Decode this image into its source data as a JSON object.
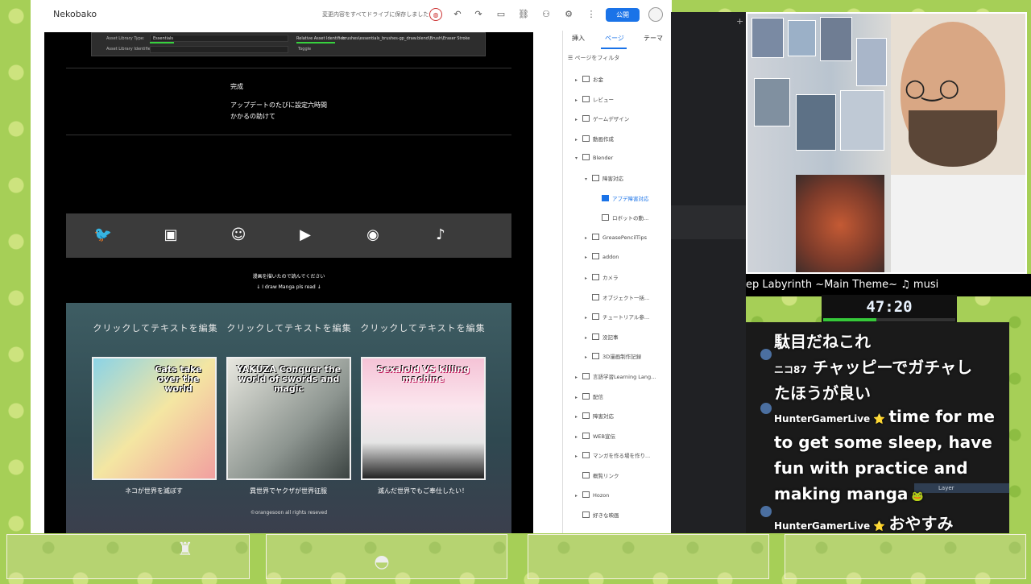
{
  "app": {
    "title": "Nekobako",
    "save_status": "変更内容をすべてドライブに保存しました",
    "publish": "公開"
  },
  "asset_panel": {
    "type_label": "Asset Library Type:",
    "type_value": "Essentials",
    "id_label": "Asset Library Identifier:",
    "rel_label": "Relative Asset Identifier:",
    "rel_value": "brushes\\essentials_brushes-gp_draw.blend\\Brush\\Eraser Stroke",
    "toggle": "Toggle"
  },
  "done": {
    "title": "完成",
    "line1": "アップデートのたびに設定六時間",
    "line2": "かかるの助けて"
  },
  "manga_note": {
    "line1": "漫画を描いたので読んでください",
    "line2": "↓ I draw Manga pls read ↓"
  },
  "manga": {
    "click_edit": "クリックしてテキストを編集",
    "covers": [
      {
        "title": "Cats take over the world",
        "caption": "ネコが世界を滅ぼす"
      },
      {
        "title": "YAKUZA Conquer the world of swords and magic",
        "caption": "異世界でヤクザが世界征服"
      },
      {
        "title": "Sexaloid VS killing machine",
        "caption": "滅んだ世界でもご奉仕したい！"
      }
    ],
    "copyright": "©orangesoon all rights reseved"
  },
  "sidebar": {
    "tabs": [
      "挿入",
      "ページ",
      "テーマ"
    ],
    "filter": "ページをフィルタ",
    "items": [
      {
        "label": "お金",
        "indent": 0,
        "arrow": "▸",
        "sel": false
      },
      {
        "label": "レビュー",
        "indent": 0,
        "arrow": "▸",
        "sel": false
      },
      {
        "label": "ゲームデザイン",
        "indent": 0,
        "arrow": "▸",
        "sel": false
      },
      {
        "label": "動画作成",
        "indent": 0,
        "arrow": "▸",
        "sel": false
      },
      {
        "label": "Blender",
        "indent": 0,
        "arrow": "▾",
        "sel": false
      },
      {
        "label": "障害対応",
        "indent": 1,
        "arrow": "▾",
        "sel": false
      },
      {
        "label": "アプデ障害対応",
        "indent": 2,
        "arrow": "",
        "sel": true
      },
      {
        "label": "ロボットの動...",
        "indent": 2,
        "arrow": "",
        "sel": false
      },
      {
        "label": "GreasePencilTips",
        "indent": 1,
        "arrow": "▸",
        "sel": false
      },
      {
        "label": "addon",
        "indent": 1,
        "arrow": "▸",
        "sel": false
      },
      {
        "label": "カメラ",
        "indent": 1,
        "arrow": "▸",
        "sel": false
      },
      {
        "label": "オブジェクト一括...",
        "indent": 1,
        "arrow": "",
        "sel": false
      },
      {
        "label": "チュートリアル参...",
        "indent": 1,
        "arrow": "▸",
        "sel": false
      },
      {
        "label": "没記事",
        "indent": 1,
        "arrow": "▸",
        "sel": false
      },
      {
        "label": "3D漫画制作記録",
        "indent": 1,
        "arrow": "▸",
        "sel": false
      },
      {
        "label": "言語学習Learning Lang...",
        "indent": 0,
        "arrow": "▸",
        "sel": false
      },
      {
        "label": "配信",
        "indent": 0,
        "arrow": "▸",
        "sel": false
      },
      {
        "label": "障害対応",
        "indent": 0,
        "arrow": "▸",
        "sel": false
      },
      {
        "label": "WEB宣伝",
        "indent": 0,
        "arrow": "▸",
        "sel": false
      },
      {
        "label": "マンガを作る場を作り...",
        "indent": 0,
        "arrow": "▸",
        "sel": false
      },
      {
        "label": "概覧リンク",
        "indent": 0,
        "arrow": "",
        "sel": false
      },
      {
        "label": "Hozon",
        "indent": 0,
        "arrow": "▸",
        "sel": false
      },
      {
        "label": "好きな映画",
        "indent": 0,
        "arrow": "",
        "sel": false
      }
    ]
  },
  "stream": {
    "music": "ep Labyrinth ~Main Theme~   ♫ musi",
    "timer": "47:20",
    "timer_progress": 0.4
  },
  "chat": [
    {
      "name": "",
      "text": "駄目だねこれ"
    },
    {
      "name": "ニコ87",
      "text": "チャッピーでガチャし"
    },
    {
      "name": "",
      "text": "たほうが良い"
    },
    {
      "name": "HunterGamerLive",
      "text": "time for me"
    },
    {
      "name": "",
      "text": "to get some sleep, have"
    },
    {
      "name": "",
      "text": "fun with practice and"
    },
    {
      "name": "",
      "text": "making manga"
    },
    {
      "name": "HunterGamerLive",
      "text": "おやすみ"
    }
  ]
}
